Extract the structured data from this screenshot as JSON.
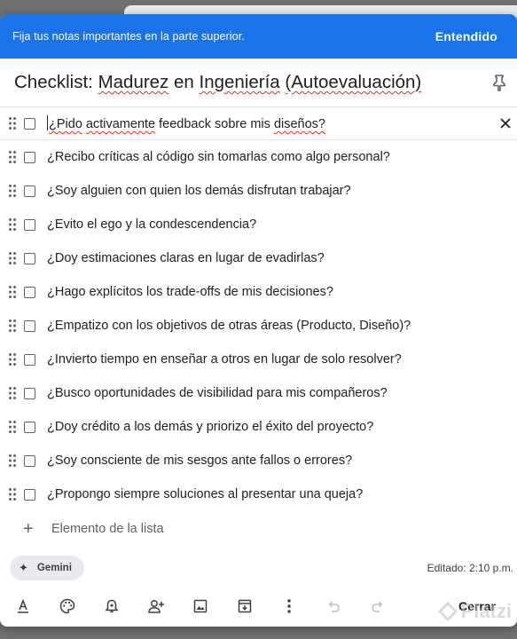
{
  "banner": {
    "text": "Fija tus notas importantes en la parte superior.",
    "button": "Entendido"
  },
  "note": {
    "title_parts": [
      {
        "text": "Checklist: ",
        "spell": false
      },
      {
        "text": "Madurez",
        "spell": true
      },
      {
        "text": " en ",
        "spell": false
      },
      {
        "text": "Ingeniería",
        "spell": true
      },
      {
        "text": " ",
        "spell": false
      },
      {
        "text": "(Autoevaluación)",
        "spell": true
      }
    ],
    "items": [
      {
        "text": "¿Pido activamente feedback sobre mis diseños?",
        "active": true,
        "checked": false
      },
      {
        "text": "¿Recibo críticas al código sin tomarlas como algo personal?",
        "active": false,
        "checked": false
      },
      {
        "text": "¿Soy alguien con quien los demás disfrutan trabajar?",
        "active": false,
        "checked": false
      },
      {
        "text": "¿Evito el ego y la condescendencia?",
        "active": false,
        "checked": false
      },
      {
        "text": "¿Doy estimaciones claras en lugar de evadirlas?",
        "active": false,
        "checked": false
      },
      {
        "text": "¿Hago explícitos los trade-offs de mis decisiones?",
        "active": false,
        "checked": false
      },
      {
        "text": "¿Empatizo con los objetivos de otras áreas (Producto, Diseño)?",
        "active": false,
        "checked": false
      },
      {
        "text": "¿Invierto tiempo en enseñar a otros en lugar de solo resolver?",
        "active": false,
        "checked": false
      },
      {
        "text": "¿Busco oportunidades de visibilidad para mis compañeros?",
        "active": false,
        "checked": false
      },
      {
        "text": "¿Doy crédito a los demás y priorizo el éxito del proyecto?",
        "active": false,
        "checked": false
      },
      {
        "text": "¿Soy consciente de mis sesgos ante fallos o errores?",
        "active": false,
        "checked": false
      },
      {
        "text": "¿Propongo siempre soluciones al presentar una queja?",
        "active": false,
        "checked": false
      }
    ],
    "add_item_label": "Elemento de la lista",
    "gemini_label": "Gemini",
    "edited": "Editado: 2:10 p.m."
  },
  "toolbar": {
    "icons": [
      "text-format-icon",
      "palette-icon",
      "reminder-icon",
      "collaborator-icon",
      "image-icon",
      "archive-icon",
      "more-icon",
      "undo-icon",
      "redo-icon"
    ],
    "close_label": "Cerrar"
  },
  "watermark": "Platzi",
  "colors": {
    "banner": "#1a73e8",
    "backdrop": "#6f7072",
    "spellcheck": "#d93025",
    "gemini_chip": "#e8eaed"
  }
}
